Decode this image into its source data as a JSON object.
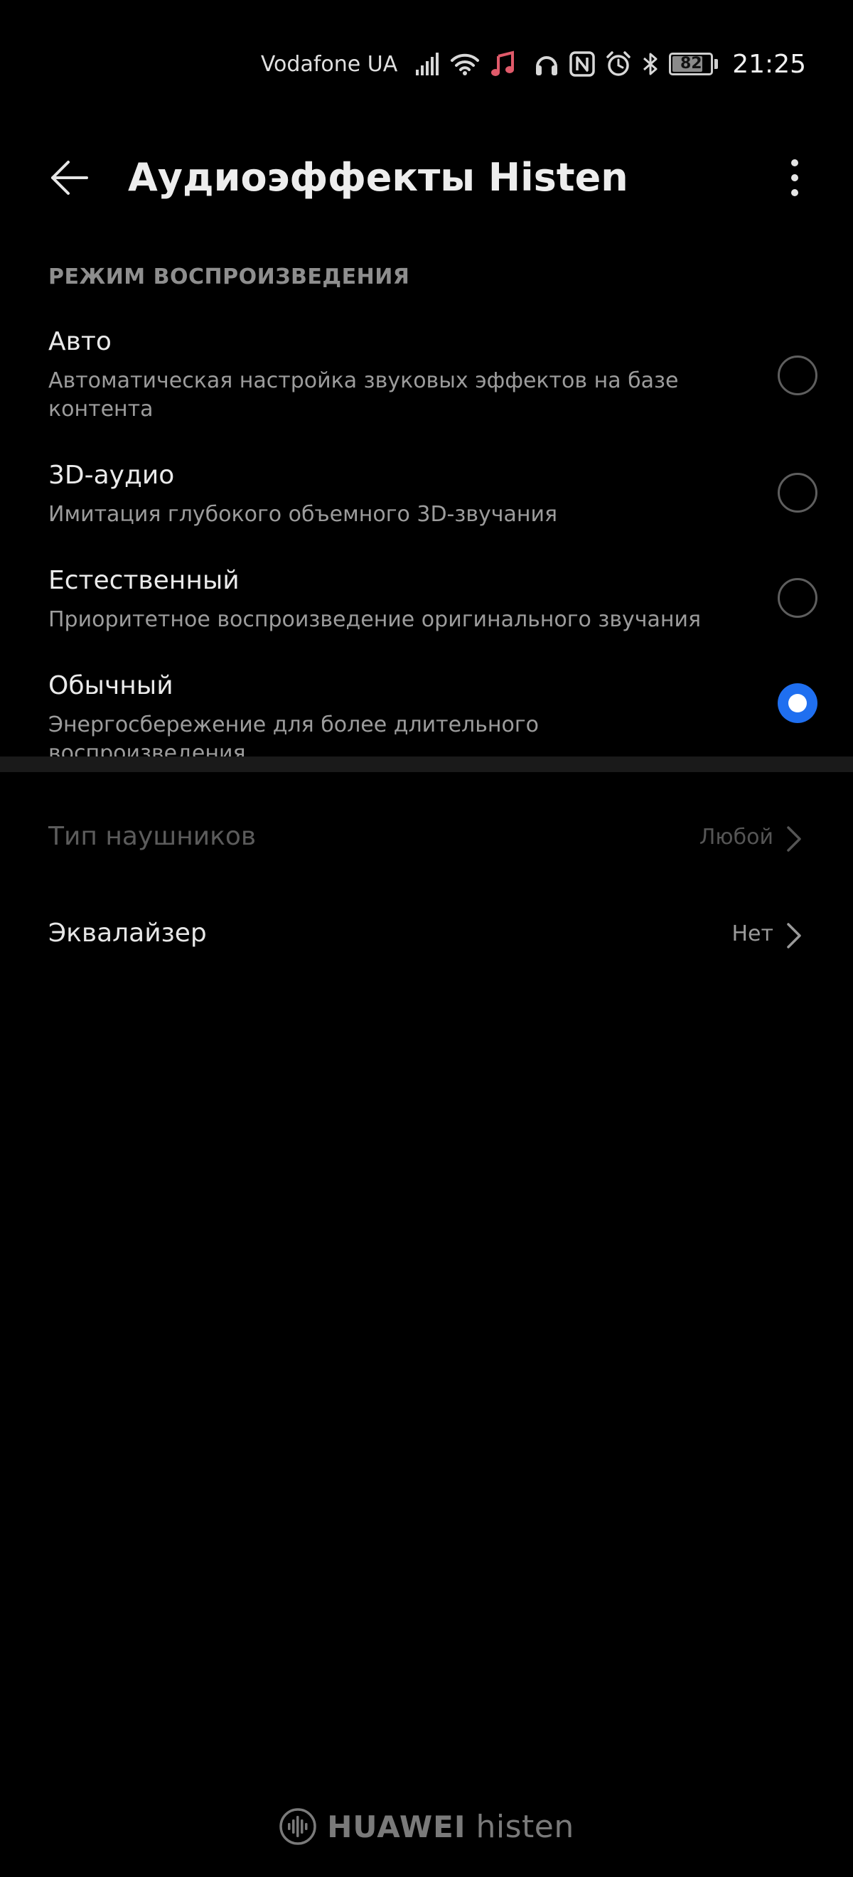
{
  "status_bar": {
    "carrier": "Vodafone UA",
    "battery_level": "82",
    "battery_fraction": 0.82,
    "time": "21:25",
    "music_icon_color": "#e05a6a",
    "icons": [
      "signal-icon",
      "wifi-icon",
      "music-note-icon",
      "headphones-icon",
      "nfc-icon",
      "alarm-icon",
      "bluetooth-icon",
      "battery-icon"
    ]
  },
  "app_bar": {
    "title": "Аудиоэффекты Histen"
  },
  "playback_mode": {
    "header": "РЕЖИМ ВОСПРОИЗВЕДЕНИЯ",
    "options": [
      {
        "title": "Авто",
        "description": "Автоматическая настройка звуковых эффектов на базе контента",
        "selected": false
      },
      {
        "title": "3D-аудио",
        "description": "Имитация глубокого объемного 3D-звучания",
        "selected": false
      },
      {
        "title": "Естественный",
        "description": "Приоритетное воспроизведение оригинального звучания",
        "selected": false
      },
      {
        "title": "Обычный",
        "description": "Энергосбережение для более длительного воспроизведения",
        "selected": true
      }
    ]
  },
  "settings": {
    "headphone_type": {
      "label": "Тип наушников",
      "value": "Любой",
      "enabled": false
    },
    "equalizer": {
      "label": "Эквалайзер",
      "value": "Нет",
      "enabled": true
    }
  },
  "footer": {
    "brand": "HUAWEI",
    "product": "histen"
  },
  "colors": {
    "background": "#000000",
    "accent": "#1f6ff0",
    "primary_text": "#eaeaea",
    "secondary_text": "#9c9c9c",
    "disabled_text": "#5c5c5c"
  }
}
